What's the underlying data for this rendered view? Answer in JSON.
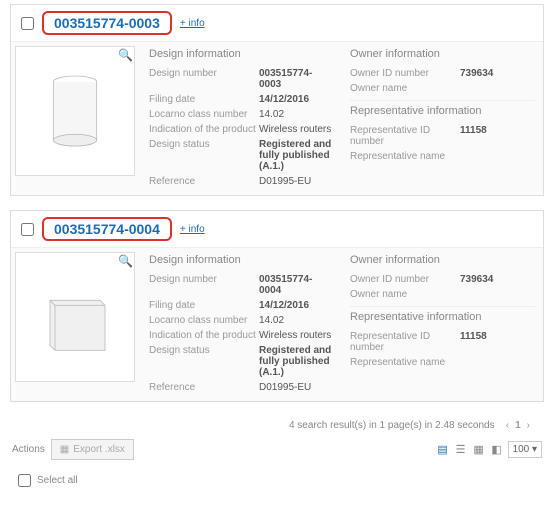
{
  "results": [
    {
      "number": "003515774-0003",
      "info_label": "+ info",
      "headers": {
        "design": "Design information",
        "owner": "Owner information",
        "rep": "Representative information"
      },
      "design": {
        "number_k": "Design number",
        "number_v": "003515774-0003",
        "filing_k": "Filing date",
        "filing_v": "14/12/2016",
        "locarno_k": "Locarno class number",
        "locarno_v": "14.02",
        "indication_k": "Indication of the product",
        "indication_v": "Wireless routers",
        "status_k": "Design status",
        "status_v": "Registered and fully published (A.1.)",
        "ref_k": "Reference",
        "ref_v": "D01995-EU"
      },
      "owner": {
        "id_k": "Owner ID number",
        "id_v": "739634",
        "name_k": "Owner name",
        "name_v": ""
      },
      "rep": {
        "id_k": "Representative ID number",
        "id_v": "11158",
        "name_k": "Representative name",
        "name_v": ""
      }
    },
    {
      "number": "003515774-0004",
      "info_label": "+ info",
      "headers": {
        "design": "Design information",
        "owner": "Owner information",
        "rep": "Representative information"
      },
      "design": {
        "number_k": "Design number",
        "number_v": "003515774-0004",
        "filing_k": "Filing date",
        "filing_v": "14/12/2016",
        "locarno_k": "Locarno class number",
        "locarno_v": "14.02",
        "indication_k": "Indication of the product",
        "indication_v": "Wireless routers",
        "status_k": "Design status",
        "status_v": "Registered and fully published (A.1.)",
        "ref_k": "Reference",
        "ref_v": "D01995-EU"
      },
      "owner": {
        "id_k": "Owner ID number",
        "id_v": "739634",
        "name_k": "Owner name",
        "name_v": ""
      },
      "rep": {
        "id_k": "Representative ID number",
        "id_v": "11158",
        "name_k": "Representative name",
        "name_v": ""
      }
    }
  ],
  "summary": "4 search result(s) in 1 page(s) in 2.48 seconds",
  "pager": {
    "prev": "‹",
    "current": "1",
    "next": "›"
  },
  "footer": {
    "actions_label": "Actions",
    "export_label": "Export .xlsx",
    "per_page": "100 ▾",
    "select_all": "Select all"
  }
}
